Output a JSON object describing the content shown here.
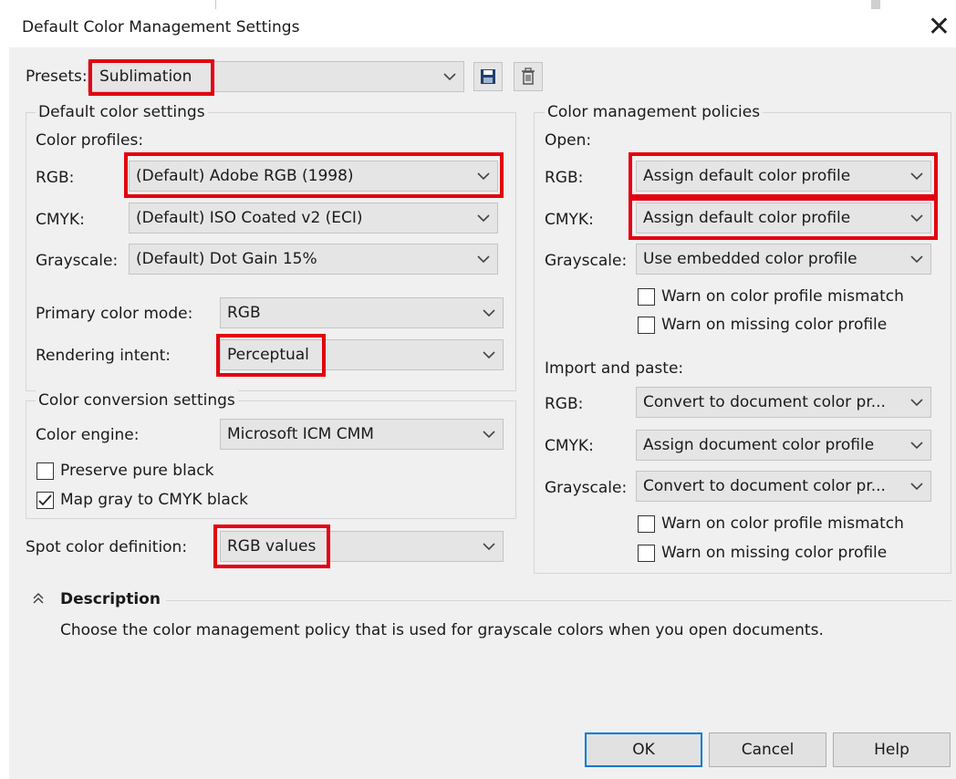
{
  "window": {
    "title": "Default Color Management Settings",
    "close_glyph": "✕"
  },
  "presets": {
    "label": "Presets:",
    "value": "Sublimation",
    "save_icon": "save-icon",
    "delete_icon": "trash-icon"
  },
  "default_color_settings": {
    "title": "Default color settings",
    "profiles_label": "Color profiles:",
    "rgb": {
      "label": "RGB:",
      "value": "(Default) Adobe RGB (1998)"
    },
    "cmyk": {
      "label": "CMYK:",
      "value": "(Default) ISO Coated v2 (ECI)"
    },
    "grayscale": {
      "label": "Grayscale:",
      "value": "(Default) Dot Gain 15%"
    },
    "primary_mode": {
      "label": "Primary color mode:",
      "value": "RGB"
    },
    "rendering_intent": {
      "label": "Rendering intent:",
      "value": "Perceptual"
    }
  },
  "color_conversion": {
    "title": "Color conversion settings",
    "engine": {
      "label": "Color engine:",
      "value": "Microsoft ICM CMM"
    },
    "preserve_black": {
      "label": "Preserve pure black",
      "checked": false
    },
    "map_gray": {
      "label": "Map gray to CMYK black",
      "checked": true
    }
  },
  "spot_color": {
    "label": "Spot color definition:",
    "value": "RGB values"
  },
  "policies": {
    "title": "Color management policies",
    "open": {
      "label": "Open:",
      "rgb": {
        "label": "RGB:",
        "value": "Assign default color profile"
      },
      "cmyk": {
        "label": "CMYK:",
        "value": "Assign default color profile"
      },
      "grayscale": {
        "label": "Grayscale:",
        "value": "Use embedded color profile"
      },
      "warn_mismatch": {
        "label": "Warn on color profile mismatch",
        "checked": false
      },
      "warn_missing": {
        "label": "Warn on missing color profile",
        "checked": false
      }
    },
    "import": {
      "label": "Import and paste:",
      "rgb": {
        "label": "RGB:",
        "value": "Convert to document color pr..."
      },
      "cmyk": {
        "label": "CMYK:",
        "value": "Assign document color profile"
      },
      "grayscale": {
        "label": "Grayscale:",
        "value": "Convert to document color pr..."
      },
      "warn_mismatch": {
        "label": "Warn on color profile mismatch",
        "checked": false
      },
      "warn_missing": {
        "label": "Warn on missing color profile",
        "checked": false
      }
    }
  },
  "description": {
    "title": "Description",
    "text": "Choose the color management policy that is used for grayscale colors when you open documents."
  },
  "buttons": {
    "ok": "OK",
    "cancel": "Cancel",
    "help": "Help"
  },
  "colors": {
    "highlight": "#e3000f",
    "dialog_bg": "#f0f0f0",
    "combo_bg": "#e5e5e5",
    "default_button_border": "#0078d7"
  }
}
